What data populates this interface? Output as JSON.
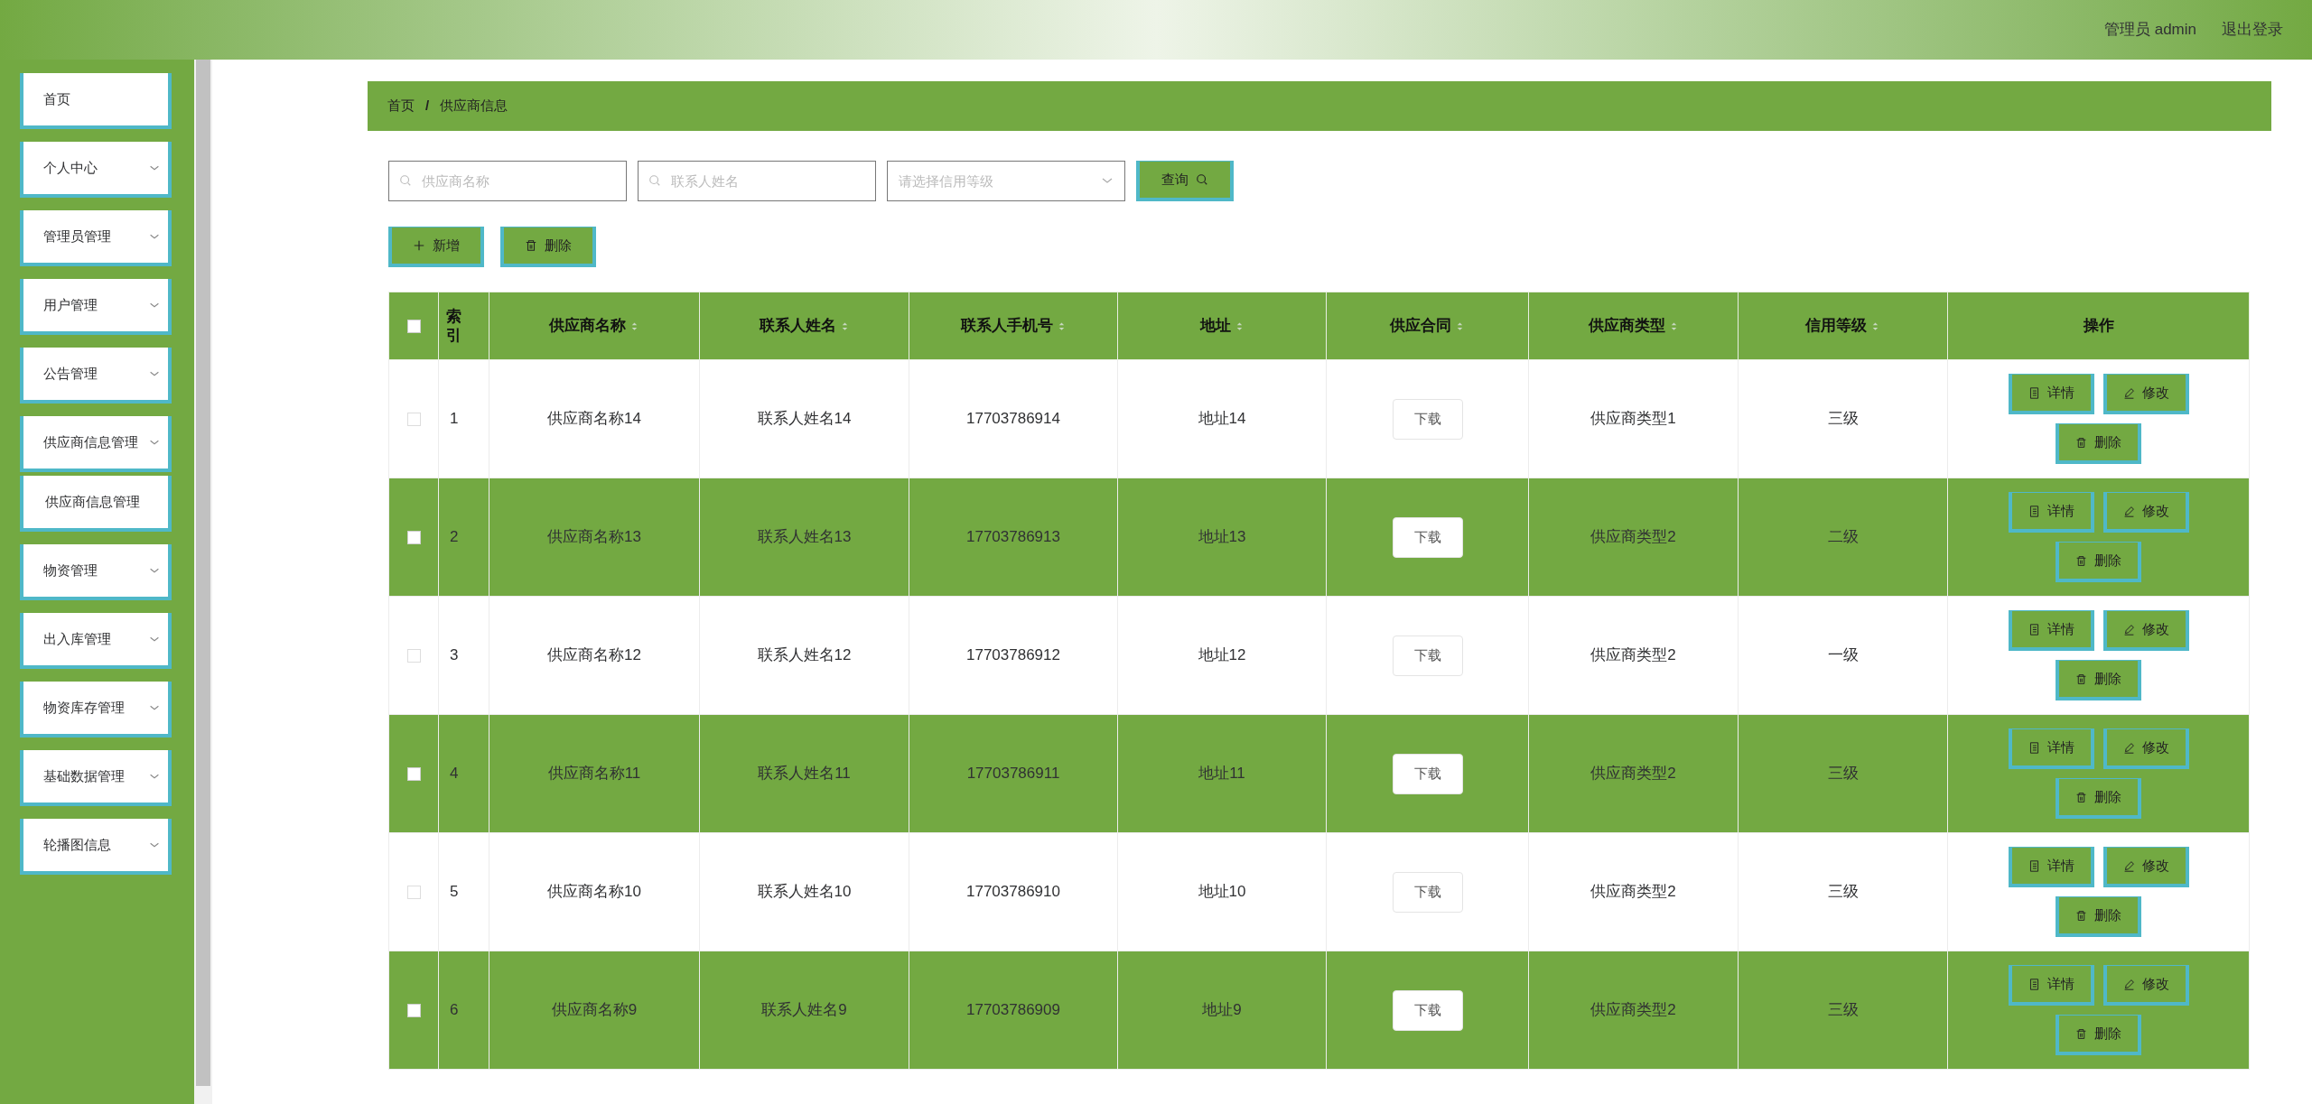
{
  "header": {
    "user": "管理员 admin",
    "logout": "退出登录"
  },
  "sidebar": {
    "items": [
      {
        "label": "首页",
        "kind": "link"
      },
      {
        "label": "个人中心",
        "kind": "menu"
      },
      {
        "label": "管理员管理",
        "kind": "menu"
      },
      {
        "label": "用户管理",
        "kind": "menu"
      },
      {
        "label": "公告管理",
        "kind": "menu"
      },
      {
        "label": "供应商信息管理",
        "kind": "menu"
      },
      {
        "label": "供应商信息管理",
        "kind": "submenu"
      },
      {
        "label": "物资管理",
        "kind": "menu"
      },
      {
        "label": "出入库管理",
        "kind": "menu"
      },
      {
        "label": "物资库存管理",
        "kind": "menu"
      },
      {
        "label": "基础数据管理",
        "kind": "menu"
      },
      {
        "label": "轮播图信息",
        "kind": "menu"
      }
    ]
  },
  "breadcrumb": [
    "首页",
    "供应商信息"
  ],
  "breadcrumb_separator": "/",
  "search": {
    "fields": [
      {
        "placeholder": "供应商名称",
        "kind": "text"
      },
      {
        "placeholder": "联系人姓名",
        "kind": "text"
      },
      {
        "placeholder": "请选择信用等级",
        "kind": "select"
      }
    ],
    "button": "查询"
  },
  "actions": [
    {
      "label": "新增",
      "kind": "add"
    },
    {
      "label": "删除",
      "kind": "delete"
    }
  ],
  "table": {
    "select_all": {
      "checked": false
    },
    "columns": [
      {
        "label": "索引",
        "sortable": false
      },
      {
        "label": "供应商名称",
        "sortable": true
      },
      {
        "label": "联系人姓名",
        "sortable": true
      },
      {
        "label": "联系人手机号",
        "sortable": true
      },
      {
        "label": "地址",
        "sortable": true
      },
      {
        "label": "供应合同",
        "sortable": true
      },
      {
        "label": "供应商类型",
        "sortable": true
      },
      {
        "label": "信用等级",
        "sortable": true
      },
      {
        "label": "操作",
        "sortable": false
      }
    ],
    "rows": [
      {
        "checked": false,
        "cells": [
          "1",
          "供应商名称14",
          "联系人姓名14",
          "17703786914",
          "地址14"
        ],
        "download": "下载",
        "type": "供应商类型1",
        "credit": "三级",
        "buttons": [
          "详情",
          "修改",
          "删除"
        ]
      },
      {
        "checked": false,
        "cells": [
          "2",
          "供应商名称13",
          "联系人姓名13",
          "17703786913",
          "地址13"
        ],
        "download": "下载",
        "type": "供应商类型2",
        "credit": "二级",
        "buttons": [
          "详情",
          "修改",
          "删除"
        ]
      },
      {
        "checked": false,
        "cells": [
          "3",
          "供应商名称12",
          "联系人姓名12",
          "17703786912",
          "地址12"
        ],
        "download": "下载",
        "type": "供应商类型2",
        "credit": "一级",
        "buttons": [
          "详情",
          "修改",
          "删除"
        ]
      },
      {
        "checked": false,
        "cells": [
          "4",
          "供应商名称11",
          "联系人姓名11",
          "17703786911",
          "地址11"
        ],
        "download": "下载",
        "type": "供应商类型2",
        "credit": "三级",
        "buttons": [
          "详情",
          "修改",
          "删除"
        ]
      },
      {
        "checked": false,
        "cells": [
          "5",
          "供应商名称10",
          "联系人姓名10",
          "17703786910",
          "地址10"
        ],
        "download": "下载",
        "type": "供应商类型2",
        "credit": "三级",
        "buttons": [
          "详情",
          "修改",
          "删除"
        ]
      },
      {
        "checked": false,
        "cells": [
          "6",
          "供应商名称9",
          "联系人姓名9",
          "17703786909",
          "地址9"
        ],
        "download": "下载",
        "type": "供应商类型2",
        "credit": "三级",
        "buttons": [
          "详情",
          "修改",
          "删除"
        ]
      }
    ]
  }
}
